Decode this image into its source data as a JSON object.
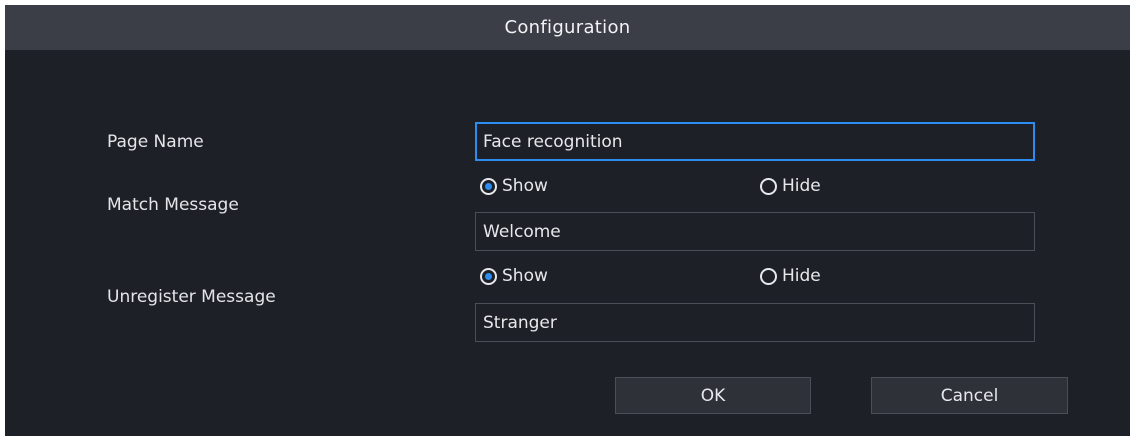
{
  "dialog": {
    "title": "Configuration",
    "page_name": {
      "label": "Page Name",
      "value": "Face recognition"
    },
    "match_message": {
      "label": "Match Message",
      "options": [
        "Show",
        "Hide"
      ],
      "selected": "Show",
      "value": "Welcome"
    },
    "unregister_message": {
      "label": "Unregister Message",
      "options": [
        "Show",
        "Hide"
      ],
      "selected": "Show",
      "value": "Stranger"
    },
    "ok_label": "OK",
    "cancel_label": "Cancel"
  },
  "colors": {
    "background": "#1d2026",
    "titlebar": "#3b3e46",
    "accent": "#2d8cf0",
    "border": "#4a4e57",
    "button": "#2e3138"
  }
}
